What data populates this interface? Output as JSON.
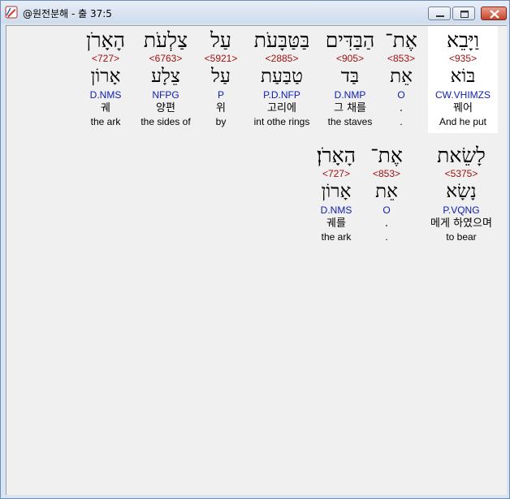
{
  "window": {
    "title": "@원전분해 - 출 37:5",
    "icon": "pencil-ruler-icon",
    "buttons": [
      "minimize-icon",
      "maximize-icon",
      "close-icon"
    ]
  },
  "words": [
    {
      "hebrew": "וַיָּבֵא",
      "strong": "<935>",
      "lemma": "בּוֹא",
      "morph": "CW.VHIMZS",
      "korean": "꿰어",
      "english": "And he put",
      "selected": true
    },
    {
      "hebrew": "אֶת־",
      "strong": "<853>",
      "lemma": "אֵת",
      "morph": "O",
      "korean": ".",
      "english": ".",
      "selected": false
    },
    {
      "hebrew": "הַבַּדִּים",
      "strong": "<905>",
      "lemma": "בַּד",
      "morph": "D.NMP",
      "korean": "그 채를",
      "english": "the staves",
      "selected": false
    },
    {
      "hebrew": "בַּטַּבָּעֹת",
      "strong": "<2885>",
      "lemma": "טַבַּעַת",
      "morph": "P.D.NFP",
      "korean": "고리에",
      "english": "int othe rings",
      "selected": false
    },
    {
      "hebrew": "עַל",
      "strong": "<5921>",
      "lemma": "עַל",
      "morph": "P",
      "korean": "위",
      "english": "by",
      "selected": false
    },
    {
      "hebrew": "צַלְעֹת",
      "strong": "<6763>",
      "lemma": "צֵלָע",
      "morph": "NFPG",
      "korean": "양편",
      "english": "the sides of",
      "selected": false
    },
    {
      "hebrew": "הָאָרֹן",
      "strong": "<727>",
      "lemma": "אָרוֹן",
      "morph": "D.NMS",
      "korean": "궤",
      "english": "the ark",
      "selected": false
    },
    {
      "hebrew": "לָשֵׂאת",
      "strong": "<5375>",
      "lemma": "נָשָׂא",
      "morph": "P.VQNG",
      "korean": "메게 하였으며",
      "english": "to bear",
      "selected": false
    },
    {
      "hebrew": "אֶת־",
      "strong": "<853>",
      "lemma": "אֵת",
      "morph": "O",
      "korean": ".",
      "english": ".",
      "selected": false
    },
    {
      "hebrew": "הָאָרֹן׃",
      "strong": "<727>",
      "lemma": "אָרוֹן",
      "morph": "D.NMS",
      "korean": "궤를",
      "english": "the ark",
      "selected": false
    }
  ]
}
